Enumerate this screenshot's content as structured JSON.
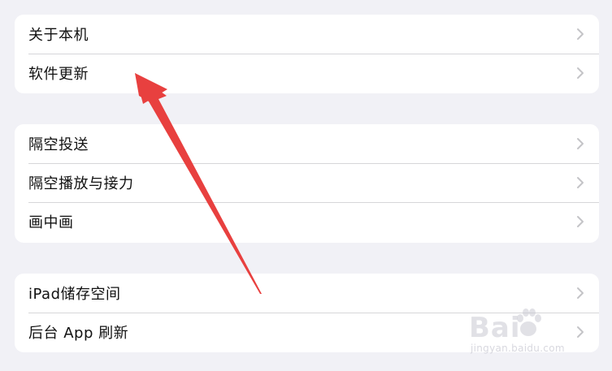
{
  "groups": [
    {
      "items": [
        {
          "label": "关于本机"
        },
        {
          "label": "软件更新"
        }
      ]
    },
    {
      "items": [
        {
          "label": "隔空投送"
        },
        {
          "label": "隔空播放与接力"
        },
        {
          "label": "画中画"
        }
      ]
    },
    {
      "items": [
        {
          "label": "iPad储存空间"
        },
        {
          "label": "后台 App 刷新"
        }
      ]
    }
  ],
  "annotation": {
    "arrow_color": "#e8403f"
  },
  "watermark": {
    "logo_text": "Baidu经验",
    "url": "jingyan.baidu.com"
  },
  "colors": {
    "background": "#f1f1f6",
    "card": "#ffffff",
    "separator": "#d6d6d9",
    "chevron": "#c4c4c7"
  }
}
